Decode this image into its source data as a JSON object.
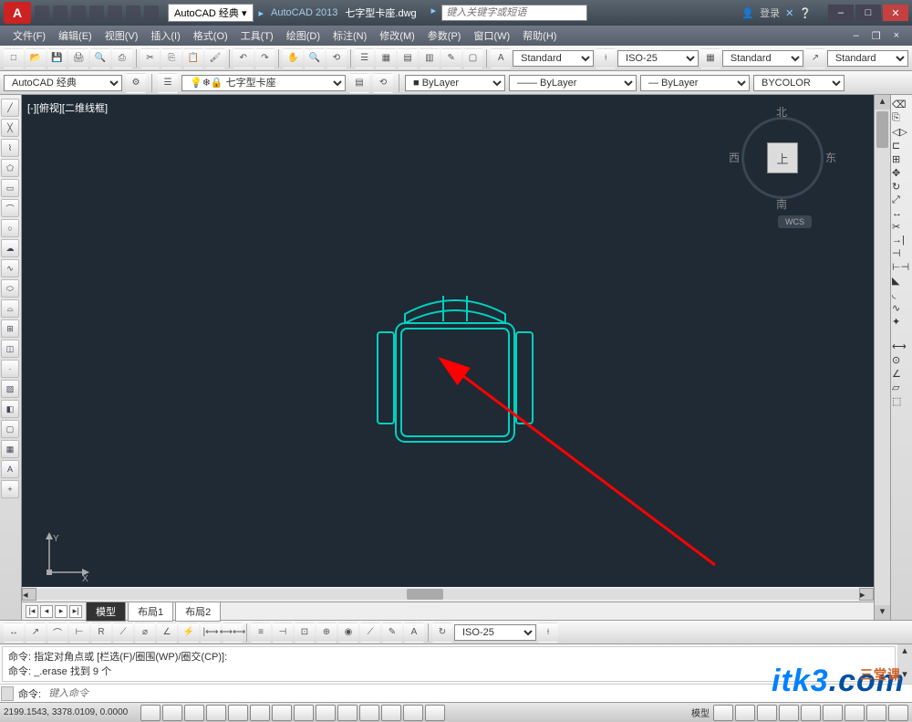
{
  "app": {
    "logo": "A",
    "workspace": "AutoCAD 经典",
    "title": "AutoCAD 2013",
    "filename": "七字型卡座.dwg",
    "search_placeholder": "键入关键字或短语",
    "login": "登录"
  },
  "menu": [
    "文件(F)",
    "编辑(E)",
    "视图(V)",
    "插入(I)",
    "格式(O)",
    "工具(T)",
    "绘图(D)",
    "标注(N)",
    "修改(M)",
    "参数(P)",
    "窗口(W)",
    "帮助(H)"
  ],
  "styles": {
    "text_style": "Standard",
    "dim_style": "ISO-25",
    "table_style": "Standard",
    "mleader_style": "Standard"
  },
  "layers": {
    "workspace2": "AutoCAD 经典",
    "current_layer": "七字型卡座",
    "layer_color": "ByLayer",
    "linetype": "ByLayer",
    "lineweight": "ByLayer",
    "plot_style": "BYCOLOR"
  },
  "viewport_label": "[-][俯视][二维线框]",
  "viewcube": {
    "n": "北",
    "s": "南",
    "e": "东",
    "w": "西",
    "face": "上",
    "wcs": "WCS"
  },
  "ucs": {
    "y": "Y",
    "x": "X"
  },
  "tabs": {
    "model": "模型",
    "layout1": "布局1",
    "layout2": "布局2"
  },
  "dim_toolbar_combo": "ISO-25",
  "cmd": {
    "line1": "命令: 指定对角点或 [栏选(F)/圈围(WP)/圈交(CP)]:",
    "line2": "命令: _.erase 找到 9 个",
    "prompt": "命令:",
    "placeholder": "键入命令"
  },
  "status": {
    "coords": "2199.1543, 3378.0109, 0.0000",
    "model_label": "模型"
  },
  "watermark": {
    "text": "itk3",
    "suffix": ".com",
    "sub": "三堂课"
  }
}
